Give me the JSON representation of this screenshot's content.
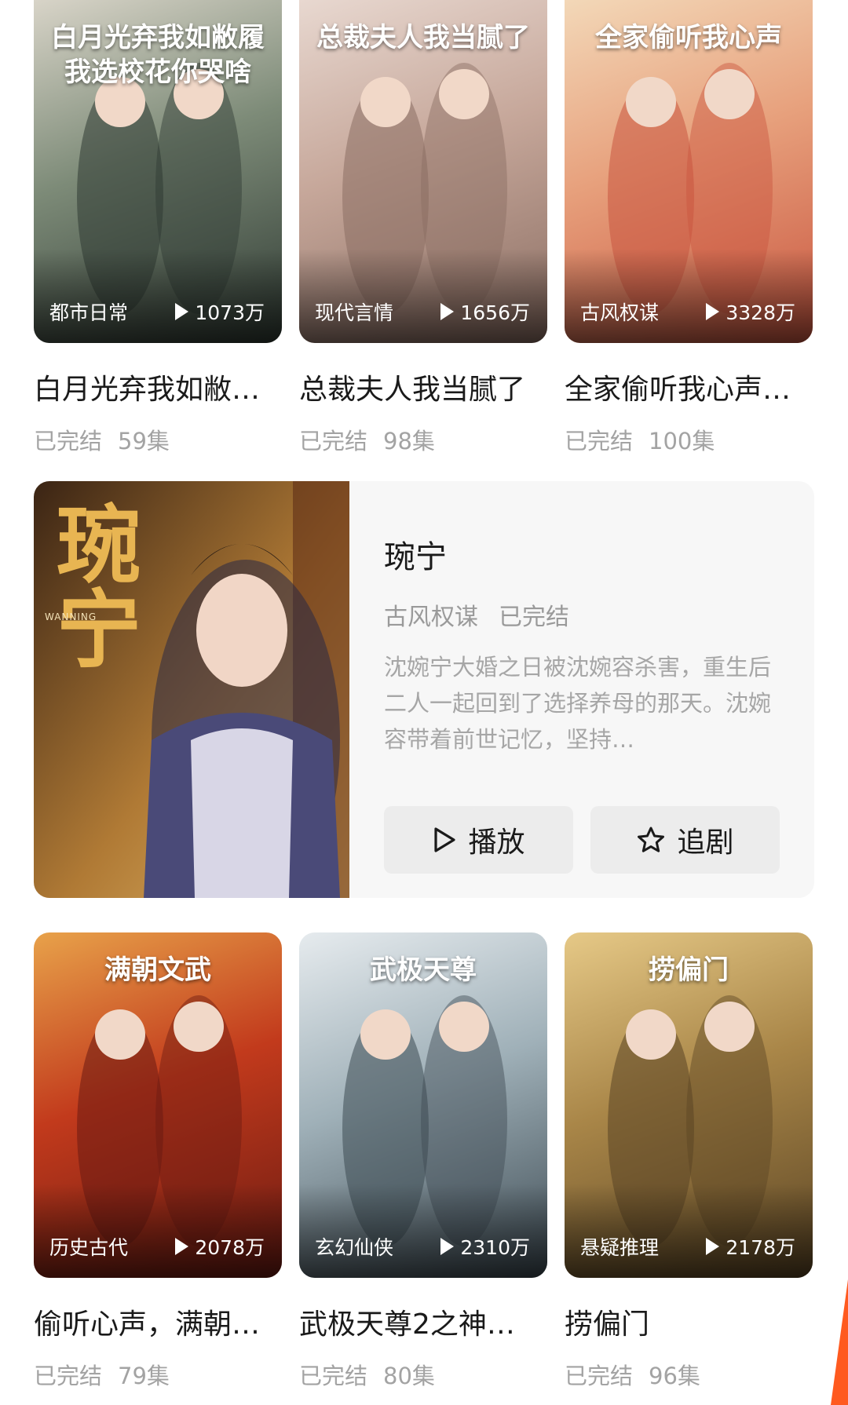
{
  "row1": [
    {
      "title": "白月光弃我如敝…",
      "genre": "都市日常",
      "views": "1073万",
      "status": "已完结",
      "episodes": "59集",
      "poster_text": "白月光弃我如敝履 我选校花你哭啥",
      "colors": [
        "#2f3a33",
        "#7d8b78",
        "#d8d4c8"
      ]
    },
    {
      "title": "总裁夫人我当腻了",
      "genre": "现代言情",
      "views": "1656万",
      "status": "已完结",
      "episodes": "98集",
      "poster_text": "总裁夫人我当腻了",
      "colors": [
        "#8a6d62",
        "#c6a79a",
        "#e8d8d0"
      ]
    },
    {
      "title": "全家偷听我心声…",
      "genre": "古风权谋",
      "views": "3328万",
      "status": "已完结",
      "episodes": "100集",
      "poster_text": "全家偷听我心声",
      "colors": [
        "#c9553f",
        "#e7a07c",
        "#f3d8b8"
      ]
    }
  ],
  "featured": {
    "title": "琬宁",
    "genre": "古风权谋",
    "status": "已完结",
    "description": "沈婉宁大婚之日被沈婉容杀害，重生后二人一起回到了选择养母的那天。沈婉容带着前世记忆，坚持…",
    "poster_text": "琬宁",
    "poster_subtext": "WANNING",
    "colors": [
      "#3a2414",
      "#b07a35",
      "#e2b86a"
    ],
    "play_label": "播放",
    "follow_label": "追剧"
  },
  "row2": [
    {
      "title": "偷听心声，满朝…",
      "genre": "历史古代",
      "views": "2078万",
      "status": "已完结",
      "episodes": "79集",
      "poster_text": "满朝文武",
      "colors": [
        "#6a1a12",
        "#c23a1c",
        "#e8a24a"
      ]
    },
    {
      "title": "武极天尊2之神…",
      "genre": "玄幻仙侠",
      "views": "2310万",
      "status": "已完结",
      "episodes": "80集",
      "poster_text": "武极天尊",
      "colors": [
        "#3d4a52",
        "#9fb0b8",
        "#e6ebee"
      ]
    },
    {
      "title": "捞偏门",
      "genre": "悬疑推理",
      "views": "2178万",
      "status": "已完结",
      "episodes": "96集",
      "poster_text": "捞偏门",
      "colors": [
        "#5a4424",
        "#a98648",
        "#e6c987"
      ]
    }
  ],
  "accent_color": "#ff5a1f"
}
